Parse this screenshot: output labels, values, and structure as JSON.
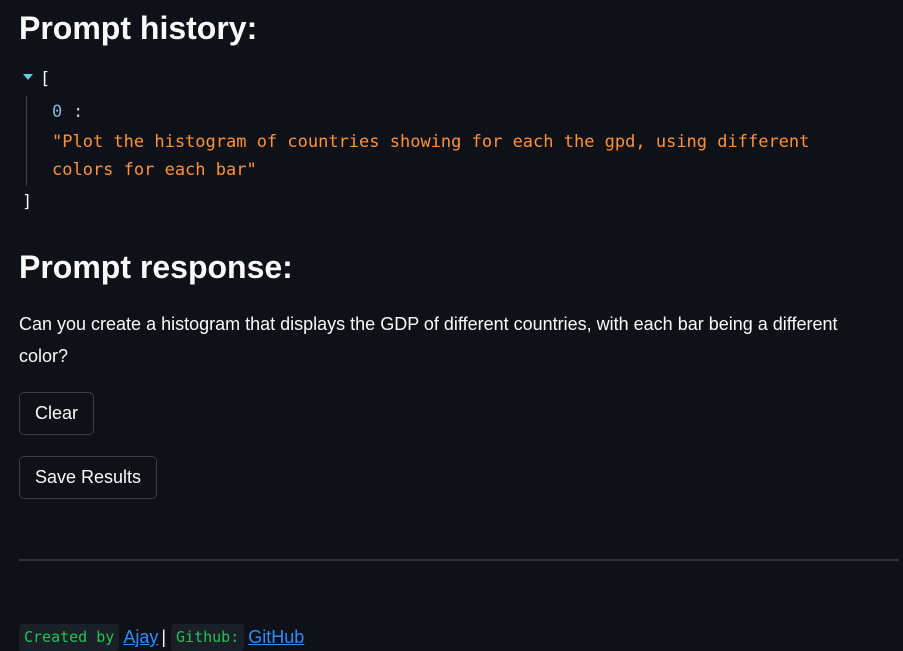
{
  "history": {
    "title": "Prompt history:",
    "open_bracket": "[",
    "close_bracket": "]",
    "items": [
      {
        "key": "0",
        "value": "\"Plot the histogram of countries showing for each the gpd, using different colors for each bar\""
      }
    ]
  },
  "response": {
    "title": "Prompt response:",
    "text": "Can you create a histogram that displays the GDP of different countries, with each bar being a different color?"
  },
  "buttons": {
    "clear_label": "Clear",
    "save_label": "Save Results"
  },
  "footer": {
    "created_by_label": "Created by",
    "author_link": "Ajay",
    "separator": "|",
    "github_label": "Github:",
    "github_link": "GitHub"
  },
  "colors": {
    "background": "#0e1117",
    "json_string": "#ff9138",
    "json_key": "#7fb6d6",
    "link": "#2f8cff",
    "code_green": "#21c354"
  }
}
